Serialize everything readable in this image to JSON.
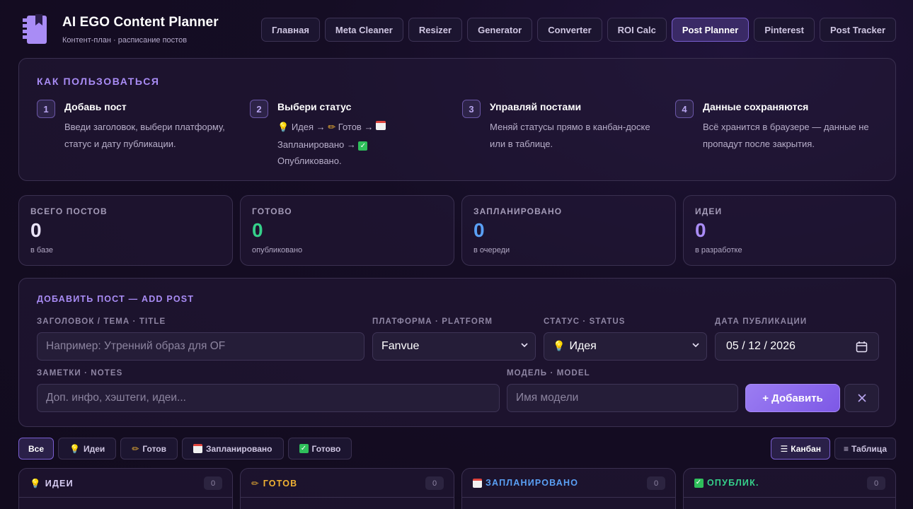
{
  "header": {
    "title": "AI EGO Content Planner",
    "subtitle": "Контент-план · расписание постов",
    "nav": [
      {
        "label": "Главная",
        "active": false
      },
      {
        "label": "Meta Cleaner",
        "active": false
      },
      {
        "label": "Resizer",
        "active": false
      },
      {
        "label": "Generator",
        "active": false
      },
      {
        "label": "Converter",
        "active": false
      },
      {
        "label": "ROI Calc",
        "active": false
      },
      {
        "label": "Post Planner",
        "active": true
      },
      {
        "label": "Pinterest",
        "active": false
      },
      {
        "label": "Post Tracker",
        "active": false
      }
    ]
  },
  "howto": {
    "title": "КАК ПОЛЬЗОВАТЬСЯ",
    "steps": [
      {
        "num": "1",
        "title": "Добавь пост",
        "text": "Введи заголовок, выбери платформу, статус и дату публикации."
      },
      {
        "num": "2",
        "title": "Выбери статус",
        "text_parts": [
          "Идея →",
          "Готов →",
          "Запланировано →",
          "Опубликовано."
        ]
      },
      {
        "num": "3",
        "title": "Управляй постами",
        "text": "Меняй статусы прямо в канбан-доске или в таблице."
      },
      {
        "num": "4",
        "title": "Данные сохраняются",
        "text": "Всё хранится в браузере — данные не пропадут после закрытия."
      }
    ]
  },
  "stats": [
    {
      "label": "ВСЕГО ПОСТОВ",
      "value": "0",
      "sub": "в базе",
      "color": "#e9e3f7"
    },
    {
      "label": "ГОТОВО",
      "value": "0",
      "sub": "опубликовано",
      "color": "#35d08a"
    },
    {
      "label": "ЗАПЛАНИРОВАНО",
      "value": "0",
      "sub": "в очереди",
      "color": "#5aa0f5"
    },
    {
      "label": "ИДЕИ",
      "value": "0",
      "sub": "в разработке",
      "color": "#a98cf5"
    }
  ],
  "form": {
    "title": "ДОБАВИТЬ ПОСТ — ADD POST",
    "title_label": "ЗАГОЛОВОК / ТЕМА · TITLE",
    "title_placeholder": "Например: Утренний образ для OF",
    "platform_label": "ПЛАТФОРМА · PLATFORM",
    "platform_value": "Fanvue",
    "status_label": "СТАТУС · STATUS",
    "status_value": "Идея",
    "date_label": "ДАТА ПУБЛИКАЦИИ",
    "date_value": "05 / 12 / 2026",
    "notes_label": "ЗАМЕТКИ · NOTES",
    "notes_placeholder": "Доп. инфо, хэштеги, идеи...",
    "model_label": "МОДЕЛЬ · MODEL",
    "model_placeholder": "Имя модели",
    "add_label": "+ Добавить"
  },
  "filters": [
    {
      "label": "Все",
      "icon": "",
      "active": true
    },
    {
      "label": "Идеи",
      "icon": "bulb-icon",
      "active": false
    },
    {
      "label": "Готов",
      "icon": "pencil-icon",
      "active": false
    },
    {
      "label": "Запланировано",
      "icon": "calendar-icon",
      "active": false
    },
    {
      "label": "Готово",
      "icon": "checkmark-icon",
      "active": false
    }
  ],
  "views": [
    {
      "label": "Канбан",
      "active": true
    },
    {
      "label": "Таблица",
      "active": false
    }
  ],
  "columns": [
    {
      "title": "ИДЕИ",
      "count": "0",
      "color": "#d8cdf4",
      "icon": "bulb-icon"
    },
    {
      "title": "ГОТОВ",
      "count": "0",
      "color": "#f0b233",
      "icon": "pencil-icon"
    },
    {
      "title": "ЗАПЛАНИРОВАНО",
      "count": "0",
      "color": "#5aa0f5",
      "icon": "calendar-icon"
    },
    {
      "title": "ОПУБЛИК.",
      "count": "0",
      "color": "#35d08a",
      "icon": "checkmark-icon"
    }
  ]
}
